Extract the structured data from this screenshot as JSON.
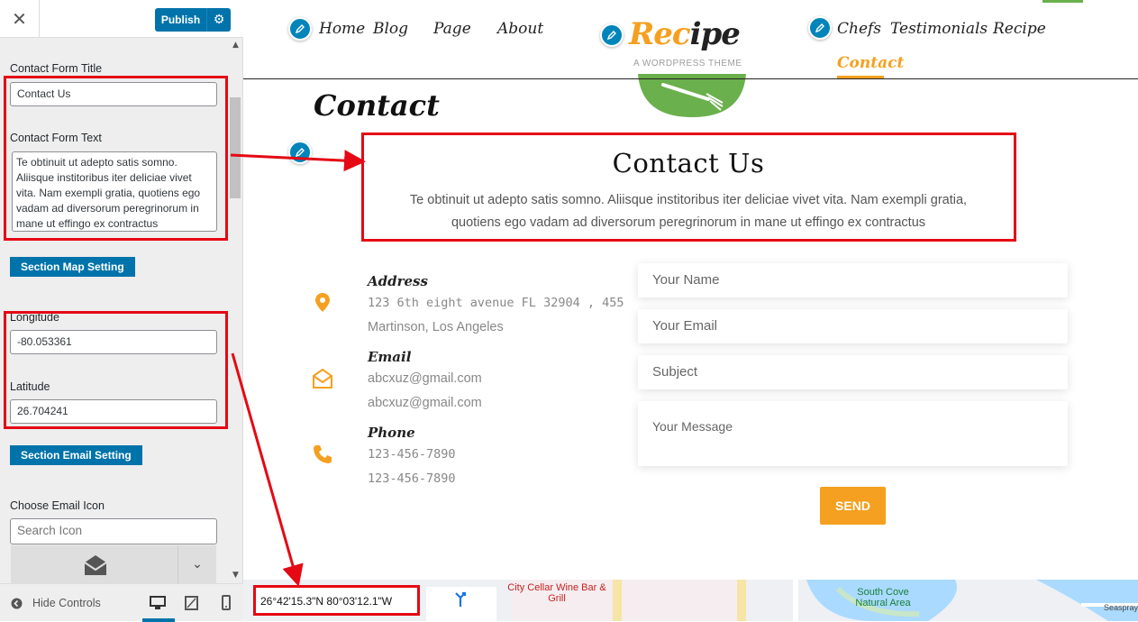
{
  "customizer": {
    "close_icon": "close-icon",
    "publish_label": "Publish",
    "contact_form_title_label": "Contact Form Title",
    "contact_form_title_value": "Contact Us",
    "contact_form_text_label": "Contact Form Text",
    "contact_form_text_value": "Te obtinuit ut adepto satis somno. Aliisque institoribus iter deliciae vivet vita. Nam exempli gratia, quotiens ego vadam ad diversorum peregrinorum in mane ut effingo ex contractus",
    "section_map_label": "Section Map Setting",
    "longitude_label": "Longitude",
    "longitude_value": "-80.053361",
    "latitude_label": "Latitude",
    "latitude_value": "26.704241",
    "section_email_label": "Section Email Setting",
    "choose_email_icon_label": "Choose Email Icon",
    "search_icon_placeholder": "Search Icon",
    "hide_controls_label": "Hide Controls"
  },
  "nav": {
    "left": [
      "Home",
      "Blog",
      "Page",
      "About"
    ],
    "right": [
      "Chefs",
      "Testimonials",
      "Recipe"
    ],
    "active": "Contact"
  },
  "logo": {
    "prefix": "Rec",
    "suffix": "ipe",
    "subtitle": "A WORDPRESS THEME"
  },
  "page_title": "Contact",
  "hero": {
    "title": "Contact Us",
    "text": "Te obtinuit ut adepto satis somno. Aliisque institoribus iter deliciae vivet vita. Nam exempli gratia, quotiens ego vadam ad diversorum peregrinorum in mane ut effingo ex contractus"
  },
  "contact_info": {
    "address_heading": "Address",
    "address_line1": "123 6th eight avenue FL 32904 , 455",
    "address_line2": "Martinson, Los Angeles",
    "email_heading": "Email",
    "email_line1": "abcxuz@gmail.com",
    "email_line2": "abcxuz@gmail.com",
    "phone_heading": "Phone",
    "phone_line1": "123-456-7890",
    "phone_line2": "123-456-7890"
  },
  "form": {
    "name_placeholder": "Your Name",
    "email_placeholder": "Your Email",
    "subject_placeholder": "Subject",
    "message_placeholder": "Your Message",
    "send_label": "SEND"
  },
  "map": {
    "coordinates": "26°42'15.3\"N 80°03'12.1\"W",
    "place1": "City Cellar Wine Bar & Grill",
    "place2": "South Cove Natural Area",
    "place3": "Seaspray"
  },
  "colors": {
    "accent": "#f5a020",
    "wp_blue": "#0073aa",
    "annotation_red": "#e50914",
    "logo_green": "#6ab04c"
  }
}
